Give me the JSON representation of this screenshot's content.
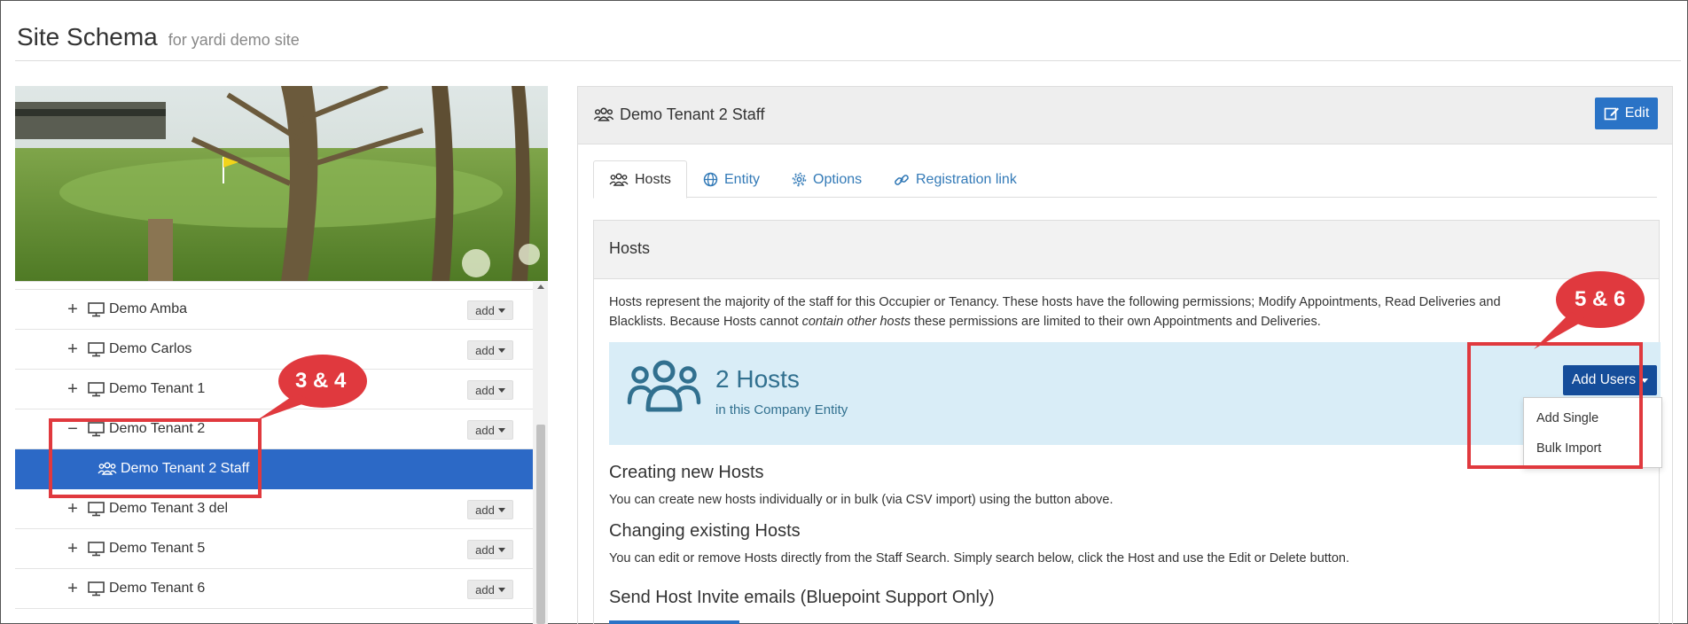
{
  "header": {
    "title": "Site Schema",
    "subtitle": "for yardi demo site"
  },
  "photo": {
    "description": "golf-course-photo"
  },
  "tree": {
    "add_label": "add",
    "rows": [
      {
        "label": "Demo Amba",
        "toggle": "+"
      },
      {
        "label": "Demo Carlos",
        "toggle": "+"
      },
      {
        "label": "Demo Tenant 1",
        "toggle": "+"
      },
      {
        "label": "Demo Tenant 2",
        "toggle": "−"
      },
      {
        "label": "Demo Tenant 2 Staff",
        "selected": true
      },
      {
        "label": "Demo Tenant 3 del",
        "toggle": "+"
      },
      {
        "label": "Demo Tenant 5",
        "toggle": "+"
      },
      {
        "label": "Demo Tenant 6",
        "toggle": "+"
      }
    ]
  },
  "panel": {
    "title": "Demo Tenant 2 Staff",
    "edit_label": "Edit",
    "tabs": [
      {
        "label": "Hosts",
        "icon": "users-icon",
        "active": true
      },
      {
        "label": "Entity",
        "icon": "globe-icon"
      },
      {
        "label": "Options",
        "icon": "gear-icon"
      },
      {
        "label": "Registration link",
        "icon": "link-icon"
      }
    ],
    "box": {
      "title": "Hosts",
      "description_1": "Hosts represent the majority of the staff for this Occupier or Tenancy. These hosts have the following permissions; Modify Appointments, Read Deliveries and",
      "description_2a": "Blacklists. Because Hosts cannot ",
      "description_2b": "contain other hosts",
      "description_2c": " these permissions are limited to their own Appointments and Deliveries.",
      "hosts_count": "2 Hosts",
      "hosts_sub": "in this Company Entity",
      "add_users_label": "Add Users",
      "dropdown": [
        "Add Single",
        "Bulk Import"
      ],
      "creating_title": "Creating new Hosts",
      "creating_text": "You can create new hosts individually or in bulk (via CSV import) using the button above.",
      "changing_title": "Changing existing Hosts",
      "changing_text": "You can edit or remove Hosts directly from the Staff Search. Simply search below, click the Host and use the Edit or Delete button.",
      "invite_title": "Send Host Invite emails (Bluepoint Support Only)"
    }
  },
  "callouts": {
    "left": "3 & 4",
    "right": "5 & 6",
    "color": "#e0393e"
  }
}
